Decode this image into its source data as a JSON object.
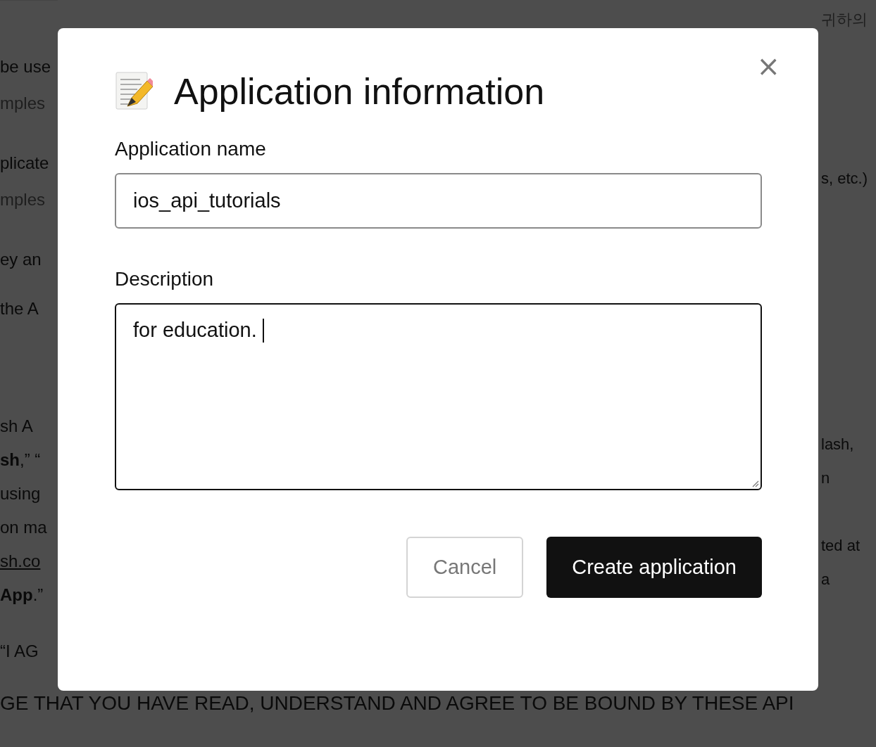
{
  "background": {
    "left_fragments": [
      {
        "text": "be use",
        "kind": "plain"
      },
      {
        "text": "mples",
        "kind": "muted"
      },
      {
        "text": "plicate",
        "kind": "plain"
      },
      {
        "text": "mples",
        "kind": "muted"
      },
      {
        "text": "ey an",
        "kind": "plain"
      },
      {
        "text": "the A",
        "kind": "plain"
      },
      {
        "text": "sh A",
        "kind": "plain"
      },
      {
        "text": "**sh**,” “",
        "kind": "plain"
      },
      {
        "text": "using",
        "kind": "plain"
      },
      {
        "text": "on ma",
        "kind": "plain"
      },
      {
        "text": "sh.co",
        "kind": "link"
      },
      {
        "text": "**App**.”",
        "kind": "plain"
      },
      {
        "text": "“I AG",
        "kind": "plain"
      }
    ],
    "right_fragments": [
      {
        "text": "귀하의",
        "kind": "muted"
      },
      {
        "text": "s, etc.)",
        "kind": "plain"
      },
      {
        "text": "lash,",
        "kind": "plain"
      },
      {
        "text": "n",
        "kind": "plain"
      },
      {
        "text": "ted at",
        "kind": "plain"
      },
      {
        "text": "a",
        "kind": "plain"
      }
    ],
    "bottom_line": "GE THAT YOU HAVE READ, UNDERSTAND AND AGREE TO BE BOUND BY THESE API"
  },
  "dialog": {
    "title": "Application information",
    "close": "×",
    "fields": [
      {
        "label": "Application name",
        "value": "ios_api_tutorials",
        "kind": "input",
        "focused": false
      },
      {
        "label": "Description",
        "value": "for education.",
        "kind": "textarea",
        "focused": true
      }
    ],
    "buttons": [
      {
        "label": "Cancel",
        "kind": "secondary"
      },
      {
        "label": "Create application",
        "kind": "primary"
      }
    ]
  }
}
